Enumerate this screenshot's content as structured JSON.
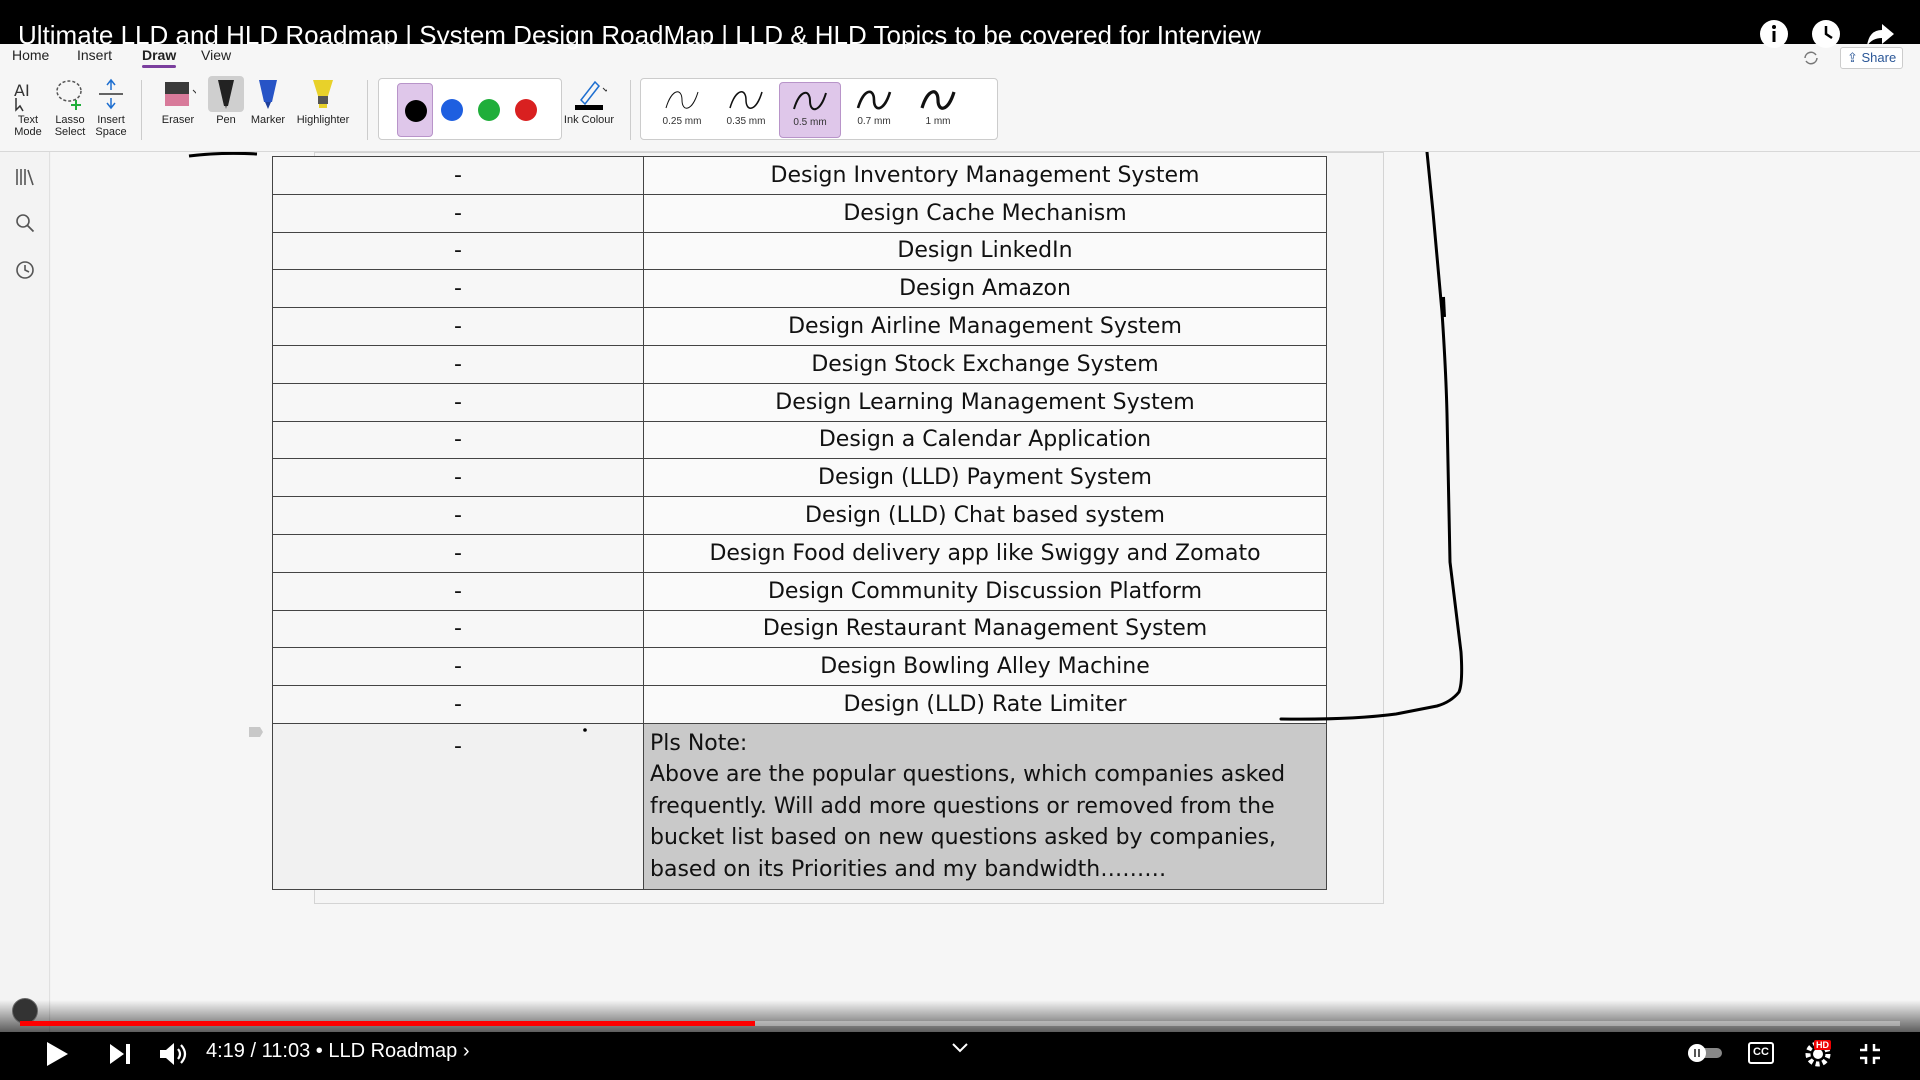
{
  "video": {
    "title": "Ultimate LLD and HLD Roadmap | System Design RoadMap | LLD & HLD Topics to be covered for Interview"
  },
  "ribbon": {
    "tabs": [
      {
        "label": "Home"
      },
      {
        "label": "Insert"
      },
      {
        "label": "Draw",
        "active": true
      },
      {
        "label": "View"
      }
    ],
    "tools": {
      "text_mode": "Text Mode",
      "lasso_select": "Lasso Select",
      "insert_space": "Insert Space",
      "eraser": "Eraser",
      "pen": "Pen",
      "marker": "Marker",
      "highlighter": "Highlighter",
      "ink_colour": "Ink Colour"
    },
    "colors": [
      "#000000",
      "#1e5fe0",
      "#1fae3a",
      "#d92020"
    ],
    "selected_color": "#000000",
    "thickness": [
      "0.25 mm",
      "0.35 mm",
      "0.5 mm",
      "0.7 mm",
      "1 mm"
    ],
    "selected_thickness": "0.5 mm",
    "share_label": "Share"
  },
  "table": {
    "rows": [
      {
        "col1": "-",
        "col2": "Design Inventory Management System"
      },
      {
        "col1": "-",
        "col2": "Design Cache Mechanism"
      },
      {
        "col1": "-",
        "col2": "Design LinkedIn"
      },
      {
        "col1": "-",
        "col2": "Design Amazon"
      },
      {
        "col1": "-",
        "col2": "Design Airline Management System"
      },
      {
        "col1": "-",
        "col2": "Design Stock Exchange System"
      },
      {
        "col1": "-",
        "col2": "Design Learning Management System"
      },
      {
        "col1": "-",
        "col2": "Design a Calendar Application"
      },
      {
        "col1": "-",
        "col2": "Design (LLD) Payment System"
      },
      {
        "col1": "-",
        "col2": "Design (LLD) Chat based system"
      },
      {
        "col1": "-",
        "col2": "Design Food delivery app like Swiggy and Zomato"
      },
      {
        "col1": "-",
        "col2": "Design Community Discussion Platform"
      },
      {
        "col1": "-",
        "col2": "Design Restaurant Management System"
      },
      {
        "col1": "-",
        "col2": "Design Bowling Alley Machine"
      },
      {
        "col1": "-",
        "col2": "Design (LLD) Rate Limiter"
      }
    ],
    "note": {
      "col1": "-",
      "heading": "Pls Note:",
      "body": "Above are the popular questions, which companies asked frequently. Will add more questions or removed from the bucket list based on new questions asked by companies, based on its Priorities and my bandwidth………"
    }
  },
  "player": {
    "current_time": "4:19",
    "duration": "11:03",
    "chapter": "LLD Roadmap",
    "progress": 0.391,
    "hd_badge": "HD",
    "cc_label": "CC"
  }
}
